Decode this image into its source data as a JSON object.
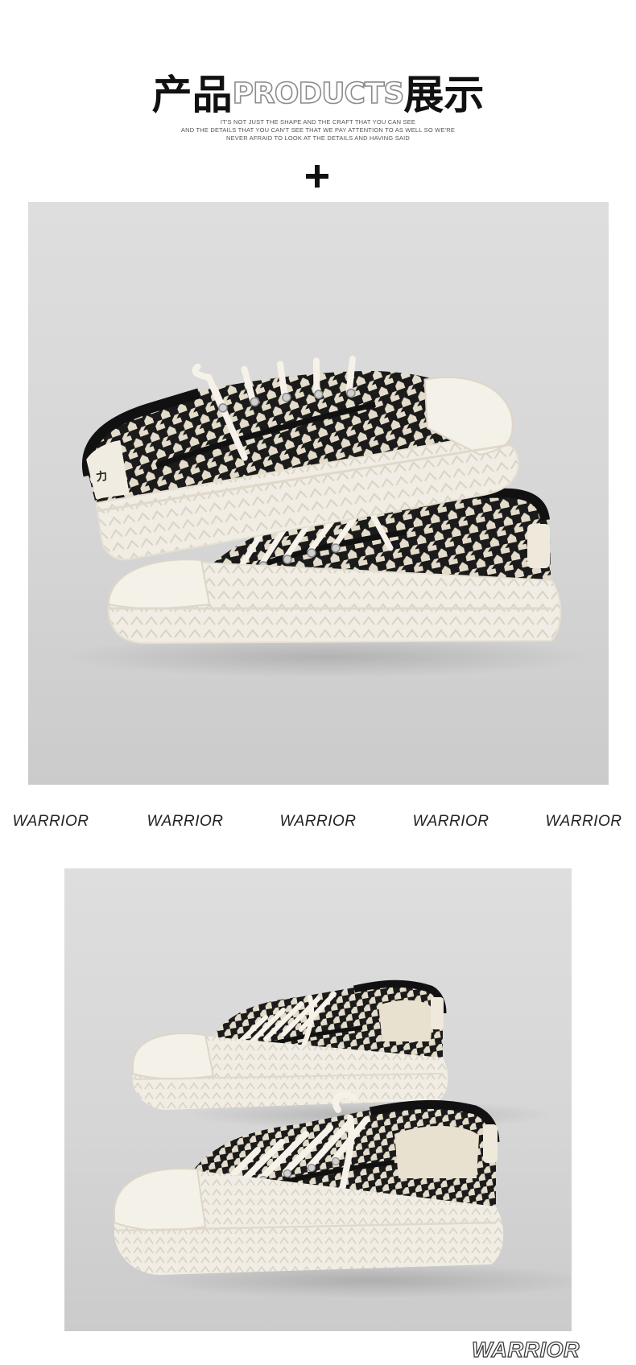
{
  "header": {
    "title_cn_left": "产品",
    "title_en": "PRODUCTS",
    "title_cn_right": "展示",
    "subtitle_lines": [
      "IT'S NOT JUST THE SHAPE AND THE CRAFT THAT YOU CAN SEE",
      "AND THE DETAILS THAT YOU CAN'T SEE THAT WE PAY ATTENTION TO AS WELL SO WE'RE",
      "NEVER AFRAID TO LOOK AT THE DETAILS AND HAVING SAID"
    ]
  },
  "warrior_band": [
    "WARRIOR",
    "WARRIOR",
    "WARRIOR",
    "WARRIOR",
    "WARRIOR"
  ],
  "footer": {
    "watermark": "WARRIOR"
  },
  "colors": {
    "backdrop": "#d8d8d8",
    "sole": "#f1ede4",
    "houndstooth_dark": "#1b1b1b",
    "houndstooth_light": "#e3dccb"
  }
}
